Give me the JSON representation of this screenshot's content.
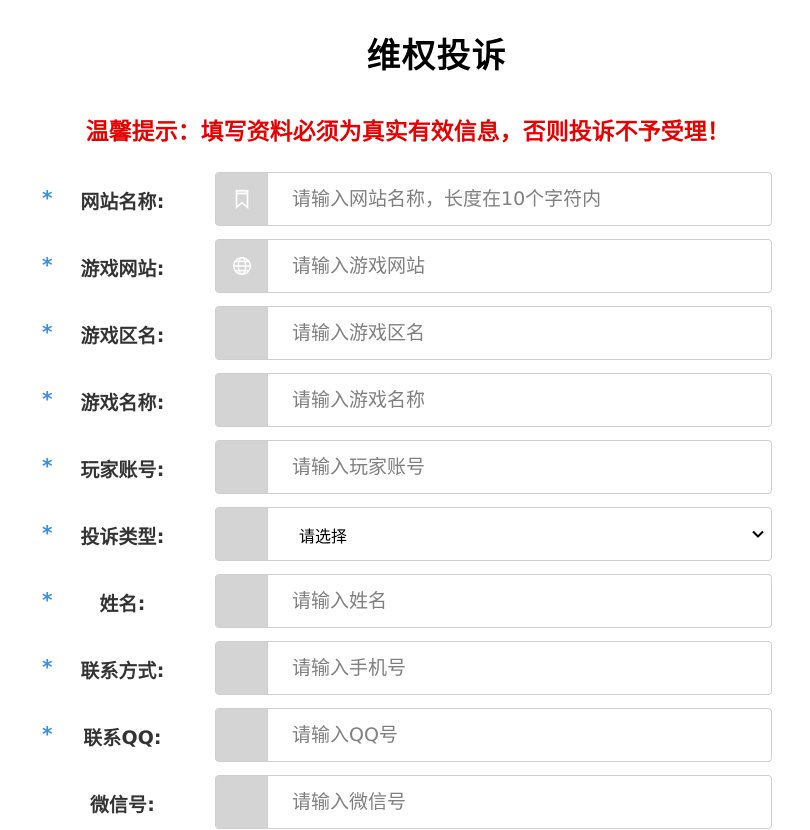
{
  "page": {
    "title": "维权投诉",
    "notice": "温馨提示：填写资料必须为真实有效信息，否则投诉不予受理！"
  },
  "form": {
    "required_mark": "*",
    "fields": [
      {
        "label": "网站名称:",
        "placeholder": "请输入网站名称，长度在10个字符内",
        "icon": "bookmark-icon",
        "required": true
      },
      {
        "label": "游戏网站:",
        "placeholder": "请输入游戏网站",
        "icon": "globe-icon",
        "required": true
      },
      {
        "label": "游戏区名:",
        "placeholder": "请输入游戏区名",
        "icon": "",
        "required": true
      },
      {
        "label": "游戏名称:",
        "placeholder": "请输入游戏名称",
        "icon": "",
        "required": true
      },
      {
        "label": "玩家账号:",
        "placeholder": "请输入玩家账号",
        "icon": "",
        "required": true
      },
      {
        "label": "投诉类型:",
        "select_value": "请选择",
        "icon": "",
        "required": true
      },
      {
        "label": "姓名:",
        "placeholder": "请输入姓名",
        "icon": "",
        "required": true
      },
      {
        "label": "联系方式:",
        "placeholder": "请输入手机号",
        "icon": "",
        "required": true
      },
      {
        "label": "联系QQ:",
        "placeholder": "请输入QQ号",
        "icon": "",
        "required": true
      },
      {
        "label": "微信号:",
        "placeholder": "请输入微信号",
        "icon": "",
        "required": false
      }
    ]
  },
  "colors": {
    "notice": "#e60000",
    "required_mark": "#3a8ee6",
    "addon_bg": "#d4d4d4"
  }
}
